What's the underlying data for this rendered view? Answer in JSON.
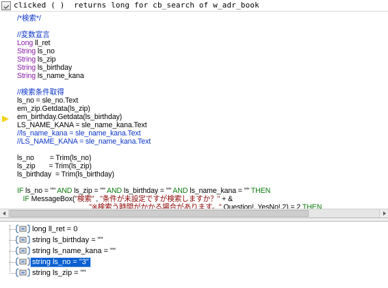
{
  "title": "clicked ( )  returns long for cb_search of w_adr_book",
  "code_lines": [
    [
      {
        "c": "cmt",
        "t": "/*検索*/"
      }
    ],
    [
      {
        "c": "txt",
        "t": ""
      }
    ],
    [
      {
        "c": "cmt",
        "t": "//変数宣言"
      }
    ],
    [
      {
        "c": "typ",
        "t": "Long"
      },
      {
        "c": "txt",
        "t": " ll_ret"
      }
    ],
    [
      {
        "c": "typ",
        "t": "String"
      },
      {
        "c": "txt",
        "t": " ls_no"
      }
    ],
    [
      {
        "c": "typ",
        "t": "String"
      },
      {
        "c": "txt",
        "t": " ls_zip"
      }
    ],
    [
      {
        "c": "typ",
        "t": "String"
      },
      {
        "c": "txt",
        "t": " ls_birthday"
      }
    ],
    [
      {
        "c": "typ",
        "t": "String"
      },
      {
        "c": "txt",
        "t": " ls_name_kana"
      }
    ],
    [
      {
        "c": "txt",
        "t": ""
      }
    ],
    [
      {
        "c": "cmt",
        "t": "//検索条件取得"
      }
    ],
    [
      {
        "c": "txt",
        "t": "ls_no = sle_no.Text"
      }
    ],
    [
      {
        "c": "txt",
        "t": "em_zip.Getdata(ls_zip)"
      }
    ],
    [
      {
        "c": "txt",
        "t": "em_birthday.Getdata(ls_birthday)"
      }
    ],
    [
      {
        "c": "txt",
        "t": "LS_NAME_KANA = sle_name_kana.Text"
      }
    ],
    [
      {
        "c": "cmt",
        "t": "//ls_name_kana = sle_name_kana.Text"
      }
    ],
    [
      {
        "c": "cmt",
        "t": "//LS_NAME_KANA = sle_name_kana.Text"
      }
    ],
    [
      {
        "c": "txt",
        "t": ""
      }
    ],
    [
      {
        "c": "txt",
        "t": "ls_no        = Trim(ls_no)"
      }
    ],
    [
      {
        "c": "txt",
        "t": "ls_zip       = Trim(ls_zip)"
      }
    ],
    [
      {
        "c": "txt",
        "t": "ls_birthday  = Trim(ls_birthday)"
      }
    ],
    [
      {
        "c": "txt",
        "t": ""
      }
    ],
    [
      {
        "c": "kw",
        "t": "IF"
      },
      {
        "c": "txt",
        "t": " ls_no = \"\" "
      },
      {
        "c": "kw",
        "t": "AND"
      },
      {
        "c": "txt",
        "t": " ls_zip = \"\" "
      },
      {
        "c": "kw",
        "t": "AND"
      },
      {
        "c": "txt",
        "t": " ls_birthday = \"\" "
      },
      {
        "c": "kw",
        "t": "AND"
      },
      {
        "c": "txt",
        "t": " ls_name_kana = \"\" "
      },
      {
        "c": "kw",
        "t": "THEN"
      }
    ],
    [
      {
        "c": "txt",
        "t": "   "
      },
      {
        "c": "kw",
        "t": "IF"
      },
      {
        "c": "txt",
        "t": " MessageBox("
      },
      {
        "c": "str",
        "t": "\"検索\""
      },
      {
        "c": "txt",
        "t": " , "
      },
      {
        "c": "str",
        "t": "\"条件が未設定ですが検索しますか？\""
      },
      {
        "c": "txt",
        "t": " + &"
      }
    ],
    [
      {
        "c": "txt",
        "t": "                                     "
      },
      {
        "c": "str",
        "t": "\"※検索う時間がかかる場合があります。\""
      },
      {
        "c": "txt",
        "t": " Question!, YesNo!,2) = 2 "
      },
      {
        "c": "kw",
        "t": "THEN"
      }
    ]
  ],
  "variables": [
    {
      "label": "long ll_ret = 0",
      "selected": false
    },
    {
      "label": "string ls_birthday = \"\"",
      "selected": false
    },
    {
      "label": "string ls_name_kana = \"\"",
      "selected": false
    },
    {
      "label": "string ls_no = \"3\"",
      "selected": true
    },
    {
      "label": "string ls_zip = \"\"",
      "selected": false
    }
  ],
  "icons": {
    "title": "script-window-icon",
    "exec": "current-line-arrow-icon",
    "variable": "variable-icon"
  },
  "colors": {
    "comment": "#0a33c8",
    "keyword": "#0b7a0b",
    "type": "#8a1aa8",
    "string": "#8b0000",
    "selection": "#0a5fd1",
    "exec_arrow": "#f3d31a"
  }
}
